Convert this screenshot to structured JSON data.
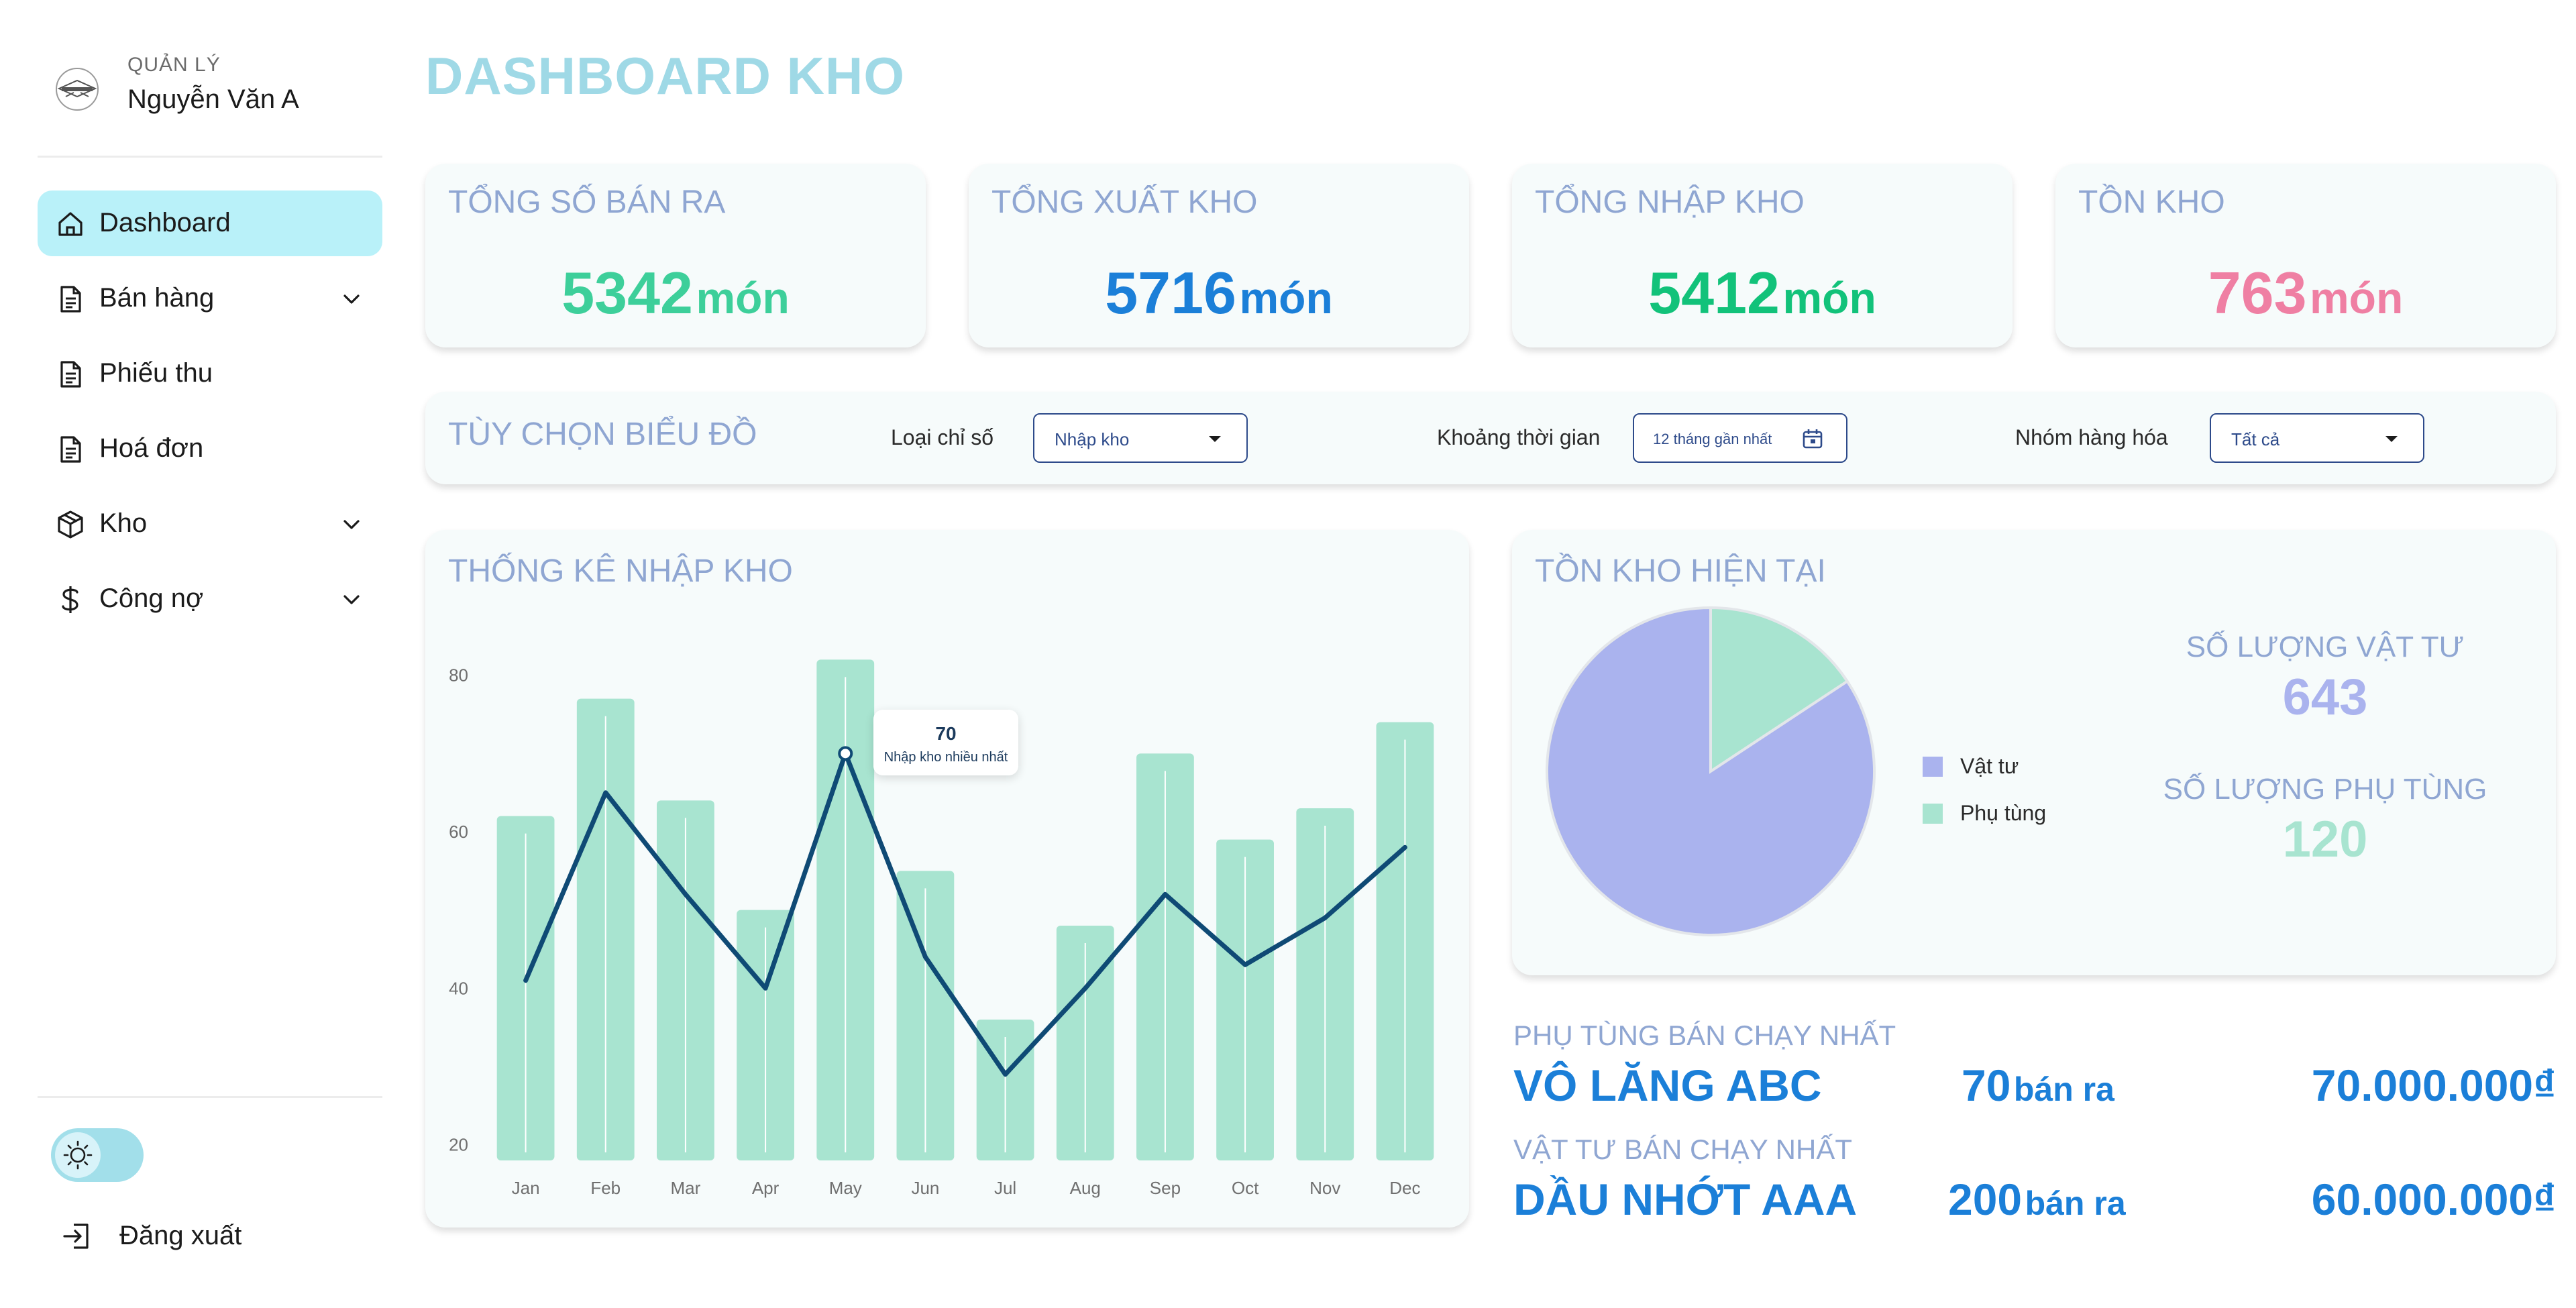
{
  "sidebar": {
    "role": "QUẢN LÝ",
    "user_name": "Nguyễn Văn A",
    "items": [
      {
        "label": "Dashboard",
        "icon": "home-icon",
        "active": true,
        "expandable": false
      },
      {
        "label": "Bán hàng",
        "icon": "document-icon",
        "active": false,
        "expandable": true
      },
      {
        "label": "Phiếu thu",
        "icon": "document-icon",
        "active": false,
        "expandable": false
      },
      {
        "label": "Hoá đơn",
        "icon": "document-icon",
        "active": false,
        "expandable": false
      },
      {
        "label": "Kho",
        "icon": "box-icon",
        "active": false,
        "expandable": true
      },
      {
        "label": "Công nợ",
        "icon": "dollar-icon",
        "active": false,
        "expandable": true
      }
    ],
    "theme_toggle_icon": "sun-icon",
    "logout_label": "Đăng xuất"
  },
  "page_title": "DASHBOARD KHO",
  "stats": [
    {
      "title": "TỔNG SỐ BÁN RA",
      "value": "5342",
      "unit": "món",
      "color": "#3dcf9a"
    },
    {
      "title": "TỔNG XUẤT KHO",
      "value": "5716",
      "unit": "món",
      "color": "#1b7fd8"
    },
    {
      "title": "TỔNG NHẬP KHO",
      "value": "5412",
      "unit": "món",
      "color": "#12c27a"
    },
    {
      "title": "TỒN KHO",
      "value": "763",
      "unit": "món",
      "color": "#ef7fa3"
    }
  ],
  "chart_options": {
    "title": "TÙY CHỌN BIỂU ĐỒ",
    "metric_label": "Loại chỉ số",
    "metric_value": "Nhập kho",
    "period_label": "Khoảng thời gian",
    "period_value": "12 tháng gần nhất",
    "group_label": "Nhóm hàng hóa",
    "group_value": "Tất cả"
  },
  "import_chart": {
    "title": "THỐNG KÊ NHẬP KHO",
    "tooltip_value": "70",
    "tooltip_label": "Nhập kho nhiều nhất"
  },
  "inventory": {
    "title": "TỒN KHO HIỆN TẠI",
    "supplies_label": "SỐ LƯỢNG VẬT TƯ",
    "supplies_value": "643",
    "parts_label": "SỐ LƯỢNG PHỤ TÙNG",
    "parts_value": "120",
    "legend": [
      {
        "label": "Vật tư",
        "color": "#aab3ee"
      },
      {
        "label": "Phụ tùng",
        "color": "#a8e4d0"
      }
    ]
  },
  "best_sellers": [
    {
      "caption": "PHỤ TÙNG BÁN CHẠY NHẤT",
      "name": "VÔ LĂNG ABC",
      "qty": "70",
      "qty_unit": "bán ra",
      "price": "70.000.000₫"
    },
    {
      "caption": "VẬT TƯ BÁN CHẠY NHẤT",
      "name": "DẦU NHỚT AAA",
      "qty": "200",
      "qty_unit": "bán ra",
      "price": "60.000.000₫"
    }
  ],
  "chart_data": [
    {
      "type": "bar",
      "title": "THỐNG KÊ NHẬP KHO",
      "categories": [
        "Jan",
        "Feb",
        "Mar",
        "Apr",
        "May",
        "Jun",
        "Jul",
        "Aug",
        "Sep",
        "Oct",
        "Nov",
        "Dec"
      ],
      "series": [
        {
          "type": "bar",
          "values": [
            62,
            77,
            64,
            50,
            82,
            55,
            36,
            48,
            70,
            59,
            63,
            74
          ]
        },
        {
          "type": "line",
          "values": [
            41,
            65,
            52,
            40,
            70,
            44,
            29,
            40,
            52,
            43,
            49,
            58
          ]
        }
      ],
      "y_ticks": [
        20,
        40,
        60,
        80
      ],
      "ylim": [
        18,
        84
      ],
      "bar_color": "#a8e4d0",
      "line_color": "#0f4a75"
    },
    {
      "type": "pie",
      "labels": [
        "Vật tư",
        "Phụ tùng"
      ],
      "values": [
        643,
        120
      ],
      "colors": [
        "#aab3ee",
        "#a8e4d0"
      ]
    }
  ]
}
